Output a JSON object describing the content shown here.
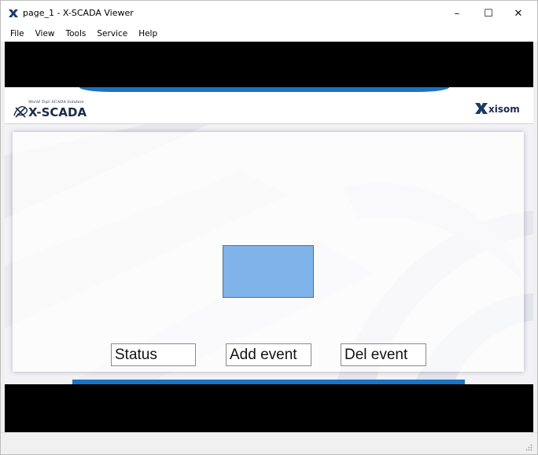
{
  "window": {
    "title": "page_1 - X-SCADA Viewer",
    "minimize": "–",
    "maximize": "☐",
    "close": "✕"
  },
  "menu": [
    "File",
    "View",
    "Tools",
    "Service",
    "Help"
  ],
  "header": {
    "left_logo": "X-SCADA",
    "left_logo_tagline": "World Top! SCADA Solution",
    "right_logo": "XISOM",
    "accent_color": "#1a73c4"
  },
  "screen": {
    "shape_color": "#7fb3ea",
    "buttons": {
      "status": "Status",
      "add_event": "Add event",
      "del_event": "Del event"
    }
  },
  "icons": {
    "app": "xisom-x-icon",
    "resize": "resize-grip-icon"
  }
}
